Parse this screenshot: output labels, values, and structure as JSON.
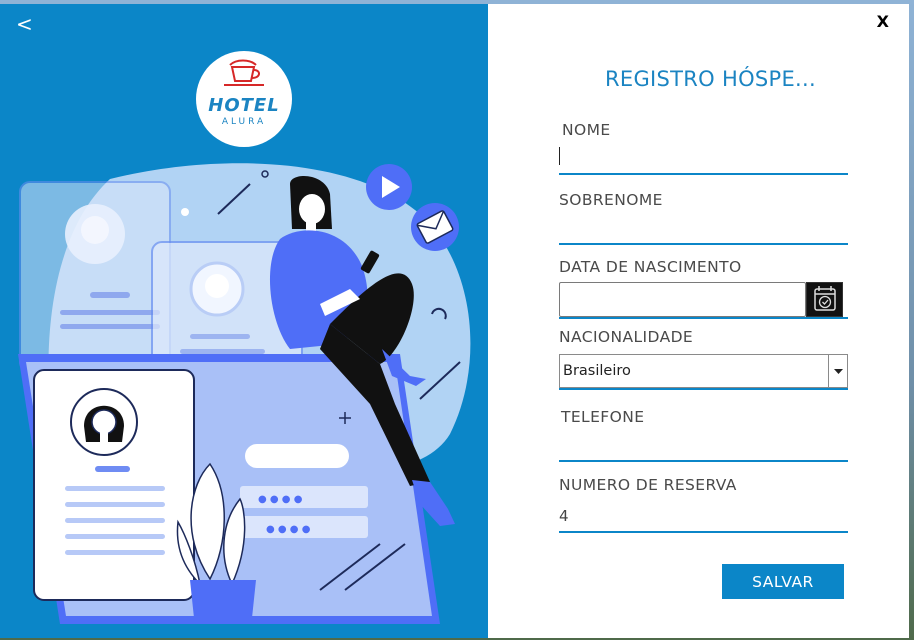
{
  "window": {
    "back_label": "<",
    "close_label": "X"
  },
  "logo": {
    "brand_name": "HOTEL",
    "brand_sub": "ALURA"
  },
  "illustration": {
    "password_mask_1": "● ● ● ●",
    "password_mask_2": "● ● ● ●"
  },
  "form": {
    "title": "REGISTRO HÓSPE...",
    "nome": {
      "label": "NOME",
      "value": ""
    },
    "sobrenome": {
      "label": "SOBRENOME",
      "value": ""
    },
    "data_nascimento": {
      "label": "DATA DE NASCIMENTO",
      "value": ""
    },
    "nacionalidade": {
      "label": "NACIONALIDADE",
      "value": "Brasileiro"
    },
    "telefone": {
      "label": "TELEFONE",
      "value": ""
    },
    "numero_reserva": {
      "label": "NUMERO DE RESERVA",
      "value": "4"
    },
    "save_label": "SALVAR"
  },
  "colors": {
    "accent": "#0b86c8",
    "illustration_blue": "#4f6ef7",
    "illustration_light": "#a9c6f5"
  }
}
